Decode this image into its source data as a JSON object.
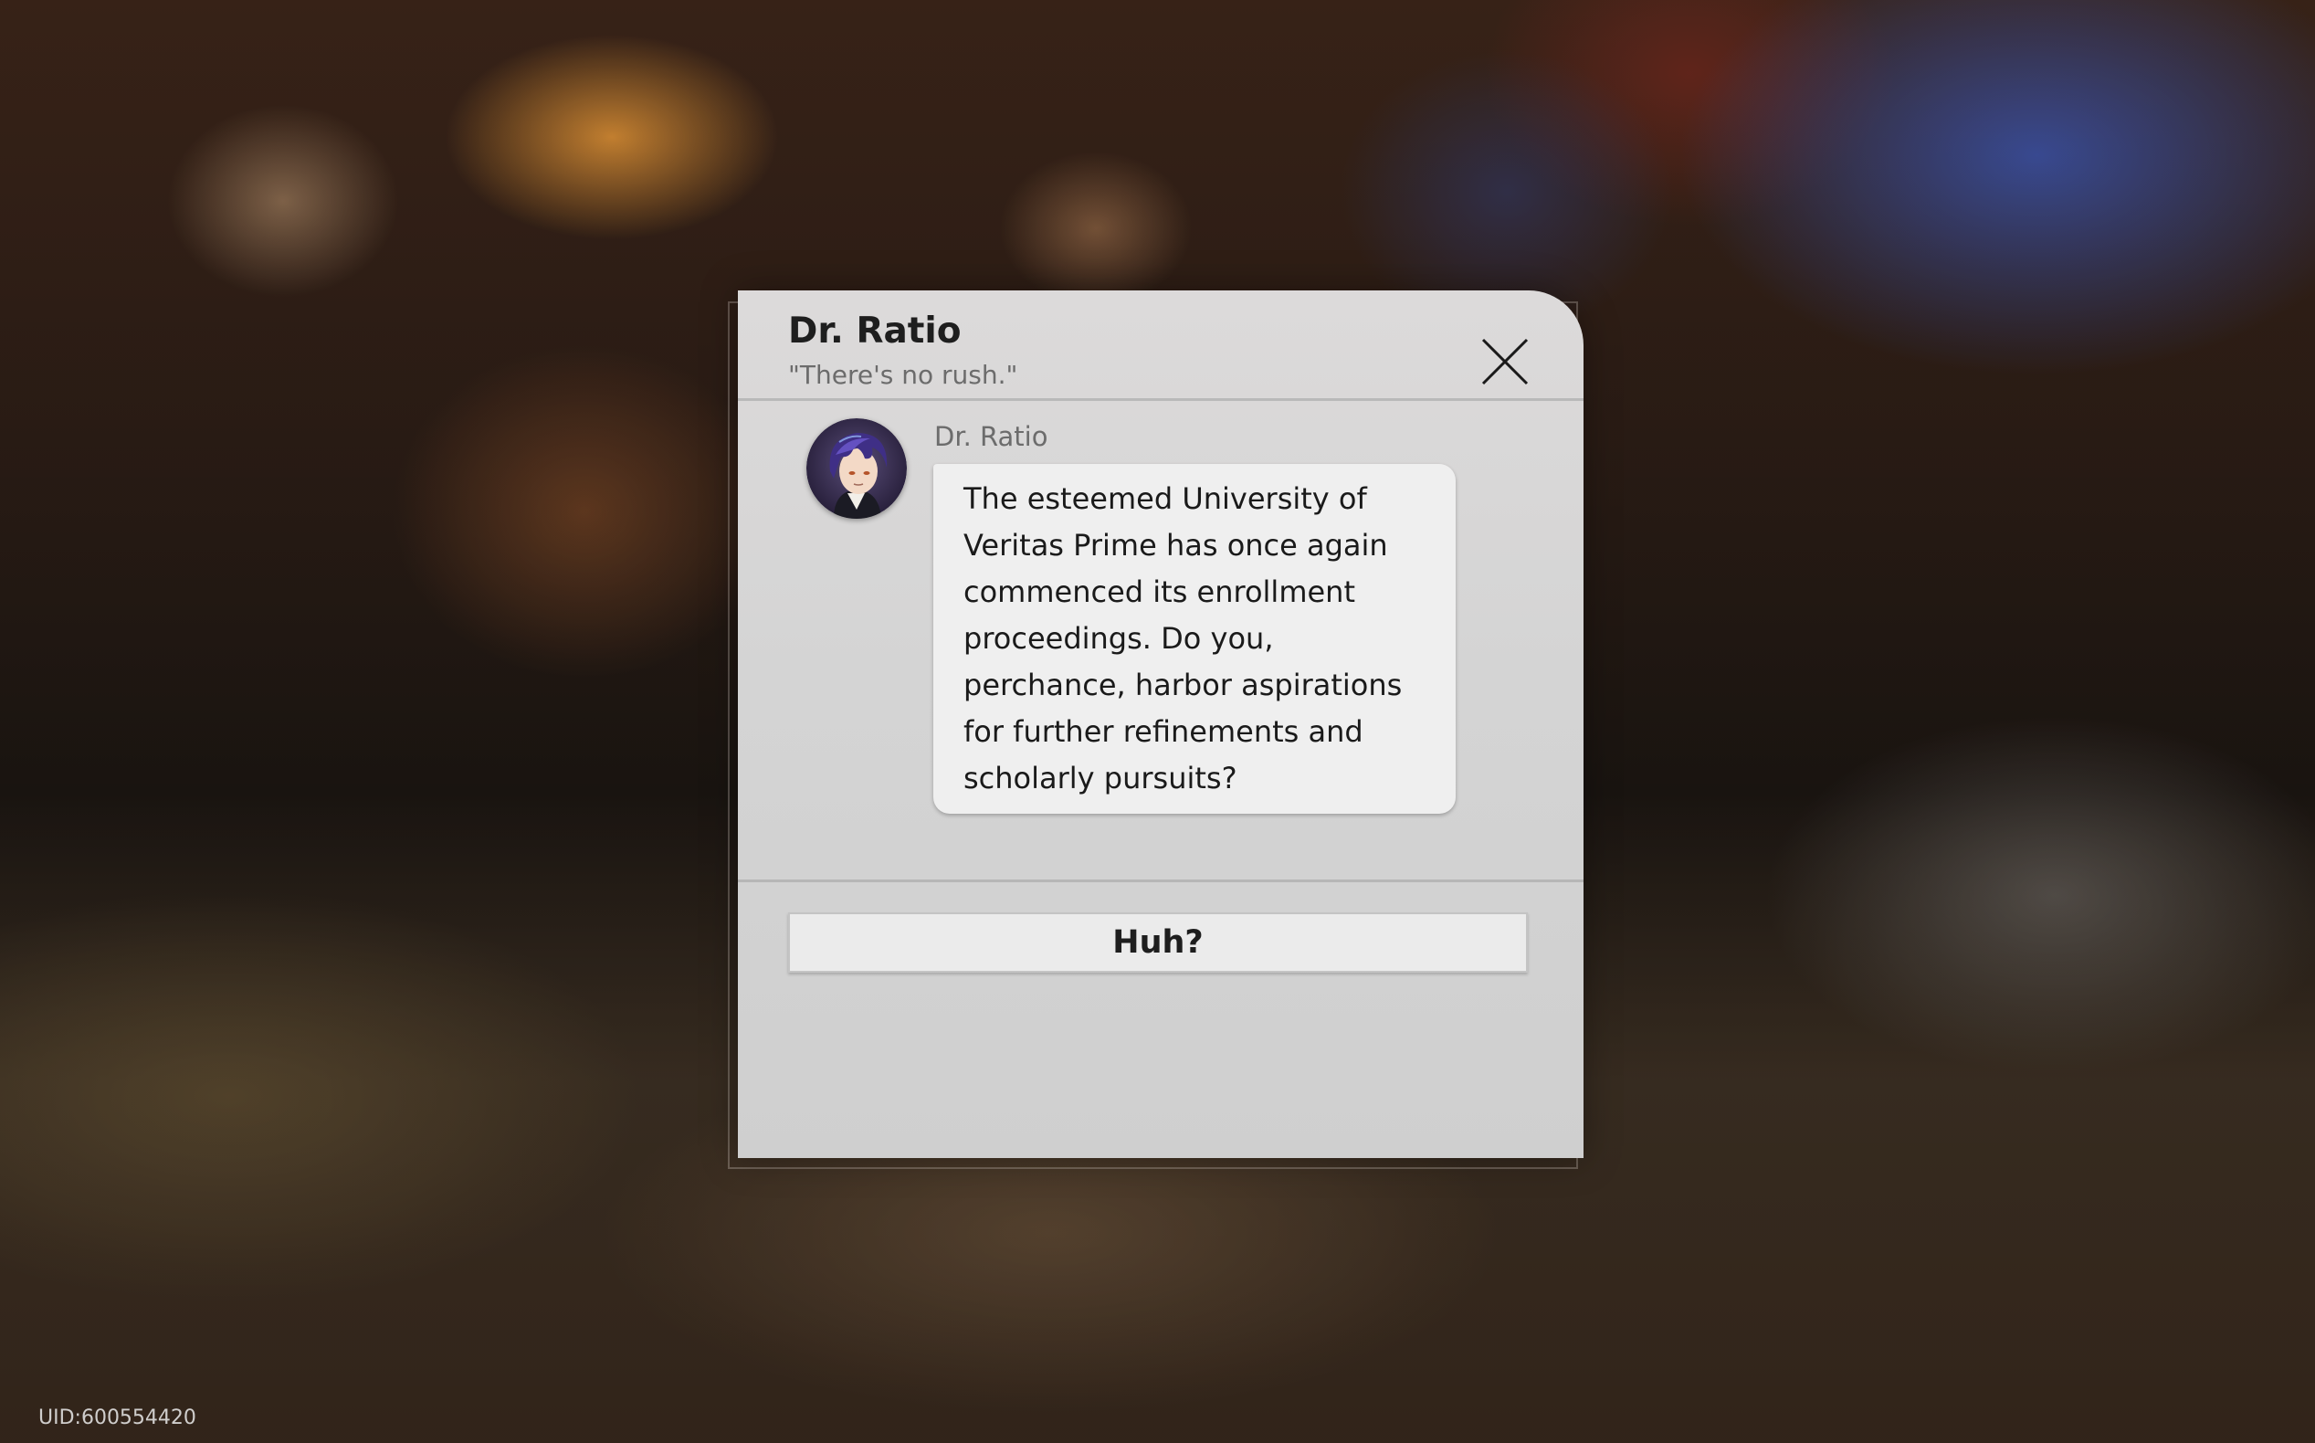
{
  "dialog": {
    "title": "Dr. Ratio",
    "subtitle": "\"There's no rush.\"",
    "close_icon": "close-x-icon"
  },
  "message": {
    "sender": "Dr. Ratio",
    "avatar_icon": "dr-ratio-avatar",
    "text": "The esteemed University of\nVeritas Prime has once again\ncommenced its enrollment\nproceedings. Do you,\nperchance, harbor aspirations\nfor further refinements and\nscholarly pursuits?"
  },
  "reply": {
    "option_label": "Huh?"
  },
  "footer": {
    "uid": "UID:600554420"
  }
}
